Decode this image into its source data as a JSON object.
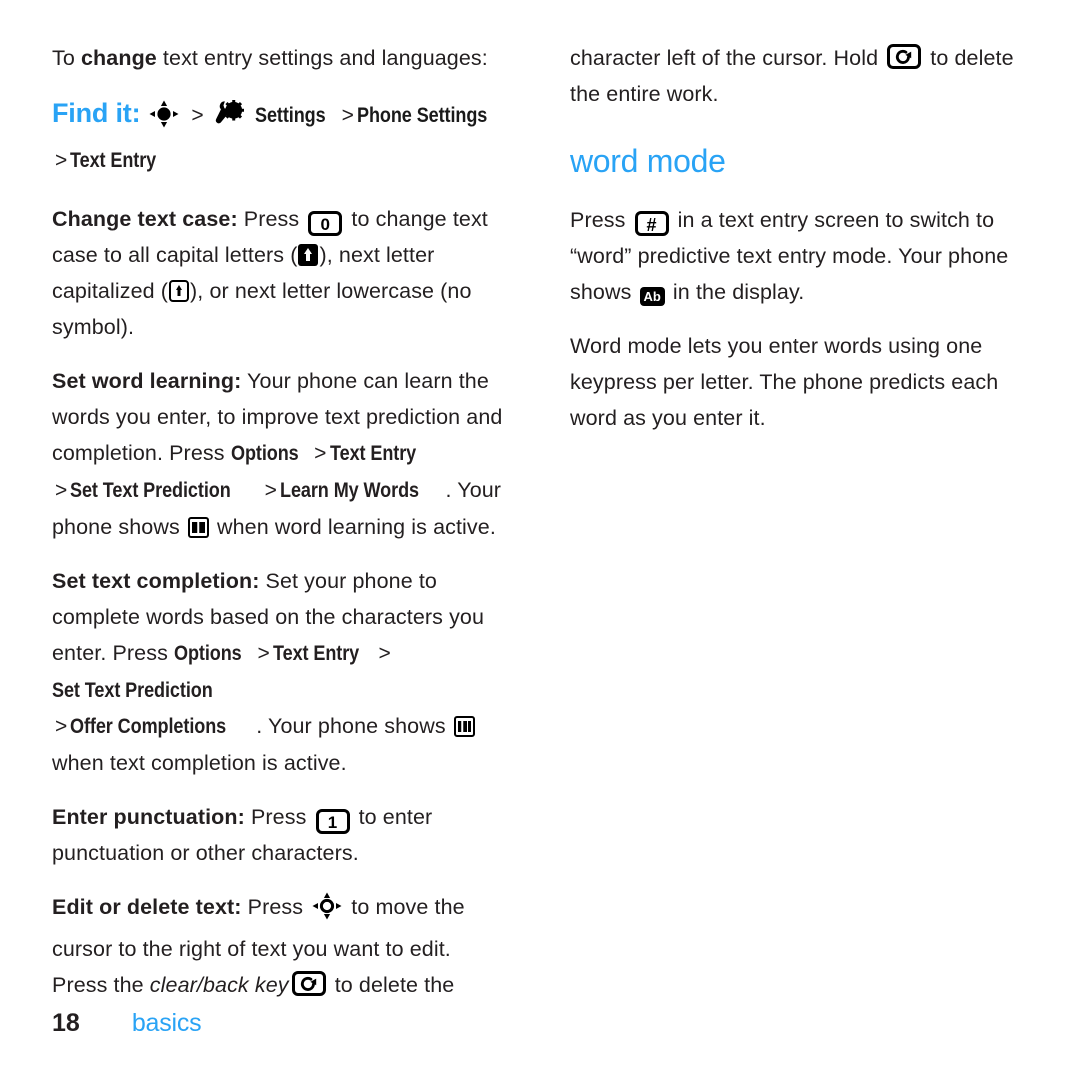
{
  "colors": {
    "accent": "#29a3f5",
    "text": "#231f20",
    "background": "#ffffff"
  },
  "left_column": {
    "intro": {
      "lead": "To ",
      "bold": "change",
      "rest": " text entry settings and languages:"
    },
    "find_it": {
      "label": "Find it:",
      "separator": ">",
      "nav_icon": "navigation-key-icon",
      "settings_icon": "settings-gear-wrench-icon",
      "steps": [
        "Settings",
        "Phone Settings",
        "Text Entry"
      ]
    },
    "entries": [
      {
        "id": "change-text-case",
        "term": "Change text case:",
        "parts": [
          " Press ",
          " to change text case to all capital letters (",
          "), next letter capitalized (",
          "), or next letter lowercase (no symbol)."
        ],
        "key_label": "0",
        "icon_caps": "caps-lock-filled-icon",
        "icon_shift": "shift-outline-icon"
      },
      {
        "id": "set-word-learning",
        "term": "Set word learning:",
        "parts": [
          " Your phone can learn the words you enter, to improve text prediction and completion. Press ",
          " > ",
          " > ",
          " > ",
          ". Your phone shows ",
          " when word learning is active."
        ],
        "menu_path": [
          "Options",
          "Text Entry",
          "Set Text Prediction",
          "Learn My Words"
        ],
        "indicator_icon": "word-learning-indicator-icon"
      },
      {
        "id": "set-text-completion",
        "term": "Set text completion:",
        "parts": [
          " Set your phone to complete words based on the characters you enter. Press ",
          " > ",
          " > ",
          " > ",
          ". Your phone shows ",
          " when text completion is active."
        ],
        "menu_path": [
          "Options",
          "Text Entry",
          "Set Text Prediction",
          "Offer Completions"
        ],
        "indicator_icon": "text-completion-indicator-icon"
      },
      {
        "id": "enter-punctuation",
        "term": "Enter punctuation:",
        "parts": [
          " Press ",
          " to enter punctuation or other characters."
        ],
        "key_label": "1"
      },
      {
        "id": "edit-or-delete-text",
        "term": "Edit or delete text:",
        "parts": [
          " Press ",
          " to move the cursor to the right of text you want to edit. Press the ",
          " to delete the"
        ],
        "italic": "clear/back key",
        "nav_icon": "navigation-key-ring-icon",
        "back_key_icon": "clear-back-key-icon"
      }
    ]
  },
  "right_column": {
    "continuation": {
      "parts": [
        "character left of the cursor. Hold ",
        " to delete the entire work."
      ],
      "back_key_icon": "clear-back-key-icon"
    },
    "section_heading": "word mode",
    "paragraphs": [
      {
        "id": "word-mode-switch",
        "parts": [
          "Press ",
          " in a text entry screen to switch to “word” predictive text entry mode. Your phone shows ",
          " in the display."
        ],
        "key_label": "#",
        "badge": "Ab"
      },
      {
        "id": "word-mode-explain",
        "text": "Word mode lets you enter words using one keypress per letter. The phone predicts each word as you enter it."
      }
    ]
  },
  "footer": {
    "page_number": "18",
    "running_head": "basics"
  }
}
